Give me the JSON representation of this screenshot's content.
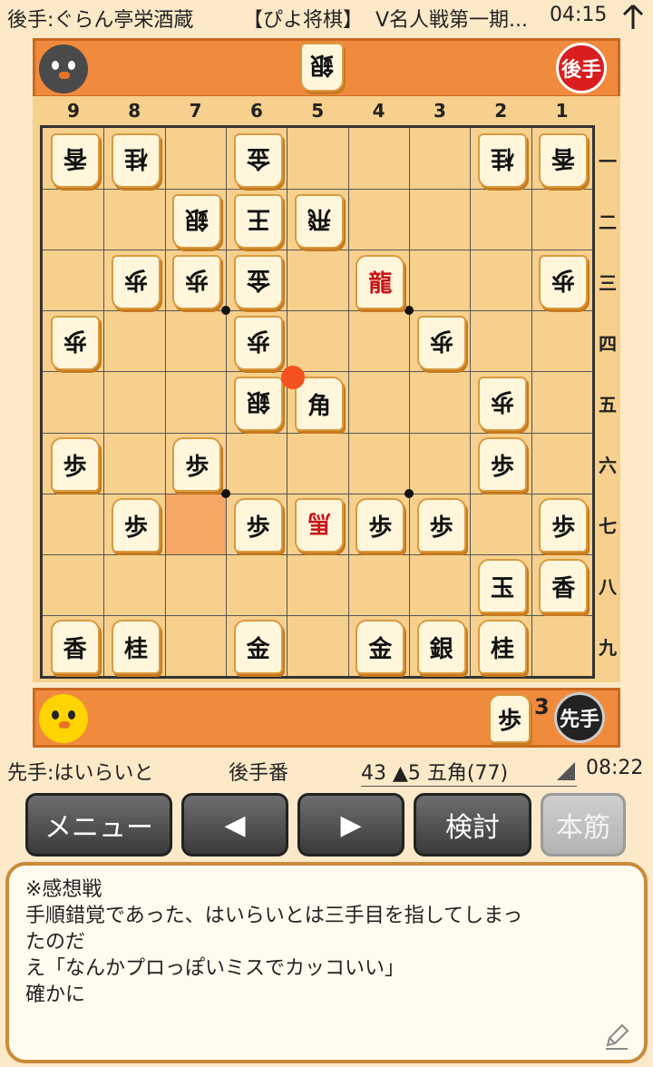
{
  "header": {
    "gote_info": "後手:ぐらん亭栄酒蔵",
    "app_name": "【ぴよ将棋】",
    "event": "V名人戦第一期...",
    "time": "04:15",
    "arrow_icon": "up-arrow-icon"
  },
  "gote_side": {
    "label": "後手",
    "hand": [
      {
        "piece": "銀",
        "count": null
      }
    ],
    "avatar": "black-chick-icon",
    "badge_color": "#d81e1e"
  },
  "sente_side": {
    "label": "先手",
    "hand": [
      {
        "piece": "歩",
        "count": "3"
      }
    ],
    "avatar": "yellow-chick-icon",
    "badge_color": "#222222"
  },
  "board": {
    "files": [
      "9",
      "8",
      "7",
      "6",
      "5",
      "4",
      "3",
      "2",
      "1"
    ],
    "ranks": [
      "一",
      "二",
      "三",
      "四",
      "五",
      "六",
      "七",
      "八",
      "九"
    ],
    "last_move_from": {
      "file": 7,
      "rank": 7
    },
    "cursor": {
      "file": 5,
      "rank": 5
    },
    "pieces": [
      {
        "file": 9,
        "rank": 1,
        "label": "香",
        "side": "gote"
      },
      {
        "file": 8,
        "rank": 1,
        "label": "桂",
        "side": "gote"
      },
      {
        "file": 6,
        "rank": 1,
        "label": "金",
        "side": "gote"
      },
      {
        "file": 2,
        "rank": 1,
        "label": "桂",
        "side": "gote"
      },
      {
        "file": 1,
        "rank": 1,
        "label": "香",
        "side": "gote"
      },
      {
        "file": 7,
        "rank": 2,
        "label": "銀",
        "side": "gote"
      },
      {
        "file": 6,
        "rank": 2,
        "label": "王",
        "side": "gote"
      },
      {
        "file": 5,
        "rank": 2,
        "label": "飛",
        "side": "gote"
      },
      {
        "file": 8,
        "rank": 3,
        "label": "歩",
        "side": "gote"
      },
      {
        "file": 7,
        "rank": 3,
        "label": "歩",
        "side": "gote"
      },
      {
        "file": 6,
        "rank": 3,
        "label": "金",
        "side": "gote"
      },
      {
        "file": 4,
        "rank": 3,
        "label": "龍",
        "side": "sente",
        "promoted": true
      },
      {
        "file": 1,
        "rank": 3,
        "label": "歩",
        "side": "gote"
      },
      {
        "file": 9,
        "rank": 4,
        "label": "歩",
        "side": "gote"
      },
      {
        "file": 6,
        "rank": 4,
        "label": "歩",
        "side": "gote"
      },
      {
        "file": 3,
        "rank": 4,
        "label": "歩",
        "side": "gote"
      },
      {
        "file": 6,
        "rank": 5,
        "label": "銀",
        "side": "gote"
      },
      {
        "file": 5,
        "rank": 5,
        "label": "角",
        "side": "sente"
      },
      {
        "file": 2,
        "rank": 5,
        "label": "歩",
        "side": "gote"
      },
      {
        "file": 9,
        "rank": 6,
        "label": "歩",
        "side": "sente"
      },
      {
        "file": 7,
        "rank": 6,
        "label": "歩",
        "side": "sente"
      },
      {
        "file": 2,
        "rank": 6,
        "label": "歩",
        "side": "sente"
      },
      {
        "file": 8,
        "rank": 7,
        "label": "歩",
        "side": "sente"
      },
      {
        "file": 6,
        "rank": 7,
        "label": "歩",
        "side": "sente"
      },
      {
        "file": 5,
        "rank": 7,
        "label": "馬",
        "side": "gote",
        "promoted": true
      },
      {
        "file": 4,
        "rank": 7,
        "label": "歩",
        "side": "sente"
      },
      {
        "file": 3,
        "rank": 7,
        "label": "歩",
        "side": "sente"
      },
      {
        "file": 1,
        "rank": 7,
        "label": "歩",
        "side": "sente"
      },
      {
        "file": 2,
        "rank": 8,
        "label": "玉",
        "side": "sente"
      },
      {
        "file": 1,
        "rank": 8,
        "label": "香",
        "side": "sente"
      },
      {
        "file": 9,
        "rank": 9,
        "label": "香",
        "side": "sente"
      },
      {
        "file": 8,
        "rank": 9,
        "label": "桂",
        "side": "sente"
      },
      {
        "file": 6,
        "rank": 9,
        "label": "金",
        "side": "sente"
      },
      {
        "file": 4,
        "rank": 9,
        "label": "金",
        "side": "sente"
      },
      {
        "file": 3,
        "rank": 9,
        "label": "銀",
        "side": "sente"
      },
      {
        "file": 2,
        "rank": 9,
        "label": "桂",
        "side": "sente"
      }
    ]
  },
  "status": {
    "sente_info": "先手:はいらいと",
    "turn": "後手番",
    "move": "43 ▲5 五角(77)",
    "clock": "08:22"
  },
  "buttons": {
    "menu": "メニュー",
    "prev_icon": "◀",
    "next_icon": "▶",
    "review": "検討",
    "mainline": "本筋"
  },
  "comment": {
    "lines": [
      "※感想戦",
      "手順錯覚であった、はいらいとは三手目を指してしまっ",
      "たのだ",
      "え「なんかプロっぽいミスでカッコいい」",
      "確かに"
    ],
    "edit_icon": "pencil-icon"
  }
}
